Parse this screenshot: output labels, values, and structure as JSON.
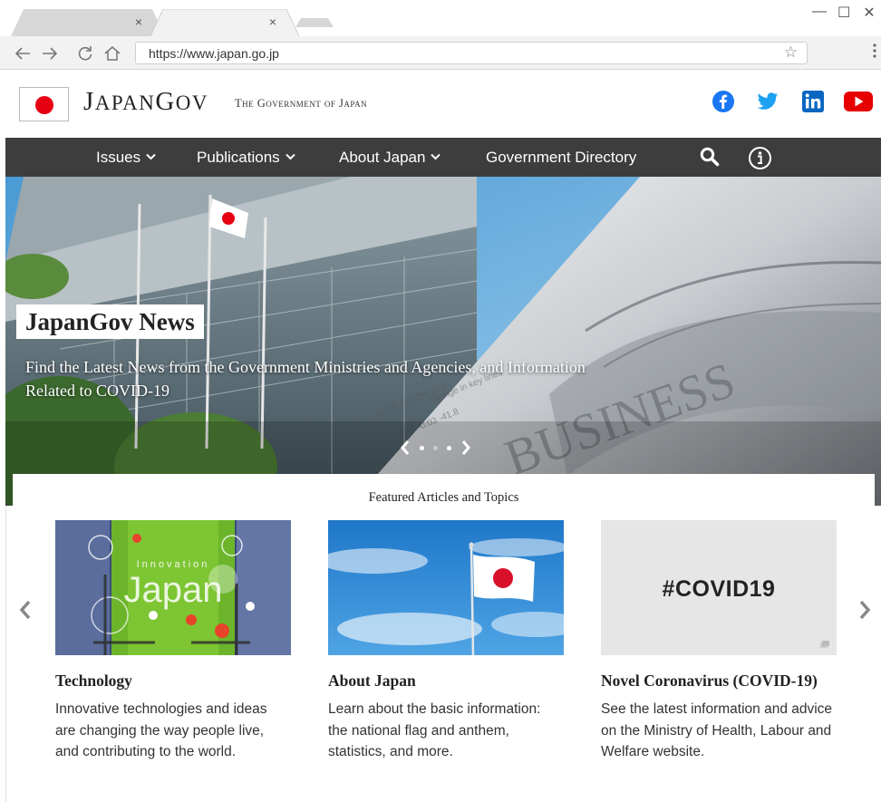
{
  "browser": {
    "tabs": [
      {
        "close": "×"
      },
      {
        "close": "×"
      }
    ],
    "window_controls": {
      "minimize": "—",
      "maximize": "☐",
      "close": "✕"
    },
    "url": "https://www.japan.go.jp",
    "star": "☆"
  },
  "header": {
    "brand": "JAPANGOV",
    "subtitle": "The Government of Japan",
    "social": [
      "facebook-icon",
      "twitter-icon",
      "linkedin-icon",
      "youtube-icon"
    ],
    "colors": {
      "facebook": "#1877f2",
      "twitter": "#1da1f2",
      "linkedin": "#0a66c2",
      "youtube": "#e60000",
      "flag_red": "#e60012"
    }
  },
  "nav": {
    "items": [
      {
        "label": "Issues",
        "dropdown": true
      },
      {
        "label": "Publications",
        "dropdown": true
      },
      {
        "label": "About Japan",
        "dropdown": true
      },
      {
        "label": "Government Directory",
        "dropdown": false
      }
    ],
    "chevron": "⌄",
    "search_icon": "search-icon",
    "info_icon": "info-icon"
  },
  "hero": {
    "title": "JapanGov News",
    "subtitle": "Find the Latest News from the Government Ministries and Agencies, and Information Related to COVID-19",
    "prev": "‹",
    "next": "›",
    "slides": 3,
    "active_slide": 1
  },
  "featured": {
    "heading": "Featured Articles and Topics",
    "prev": "‹",
    "next": "›",
    "cards": [
      {
        "title": "Technology",
        "description": "Innovative technologies and ideas are changing the way people live, and contributing to the world.",
        "image_text": "Japan",
        "image_text_small": "Innovation"
      },
      {
        "title": "About Japan",
        "description": "Learn about the basic information: the national flag and anthem, statistics, and more."
      },
      {
        "title": "Novel Coronavirus (COVID-19)",
        "description": "See the latest information and advice on the Ministry of Health, Labour and Welfare website.",
        "image_text": "#COVID19"
      }
    ]
  }
}
